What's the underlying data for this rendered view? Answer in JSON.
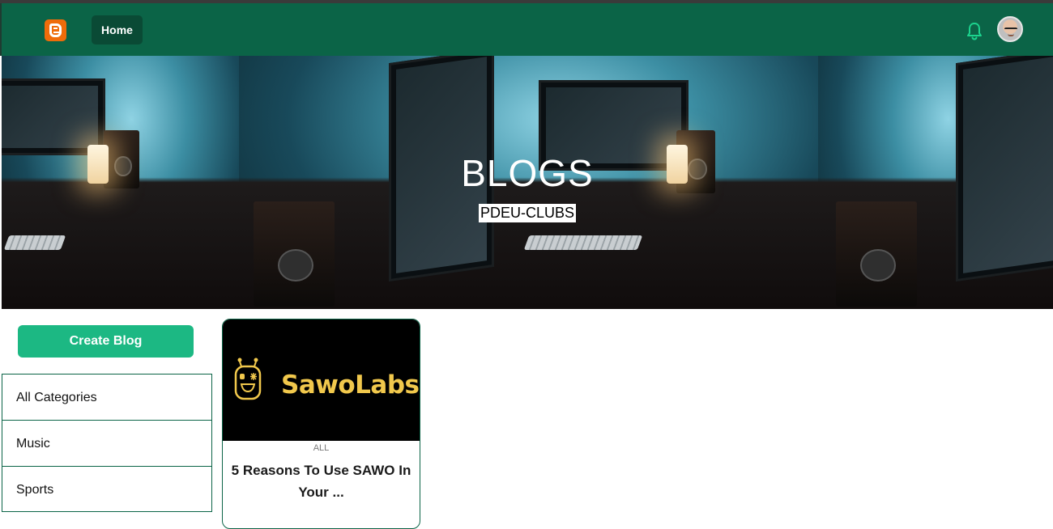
{
  "navbar": {
    "home_label": "Home",
    "logo_icon": "blogger-logo-icon",
    "notification_icon": "bell-icon",
    "avatar_icon": "user-avatar",
    "bg_color": "#0b6447",
    "accent_color": "#1cb883"
  },
  "hero": {
    "title": "BLOGS",
    "subtitle": "PDEU-CLUBS"
  },
  "sidebar": {
    "create_label": "Create Blog",
    "categories": [
      {
        "label": "All Categories"
      },
      {
        "label": "Music"
      },
      {
        "label": "Sports"
      }
    ]
  },
  "posts": [
    {
      "image_text": "SawoLabs",
      "category": "ALL",
      "title": "5 Reasons To Use SAWO In Your ..."
    }
  ]
}
